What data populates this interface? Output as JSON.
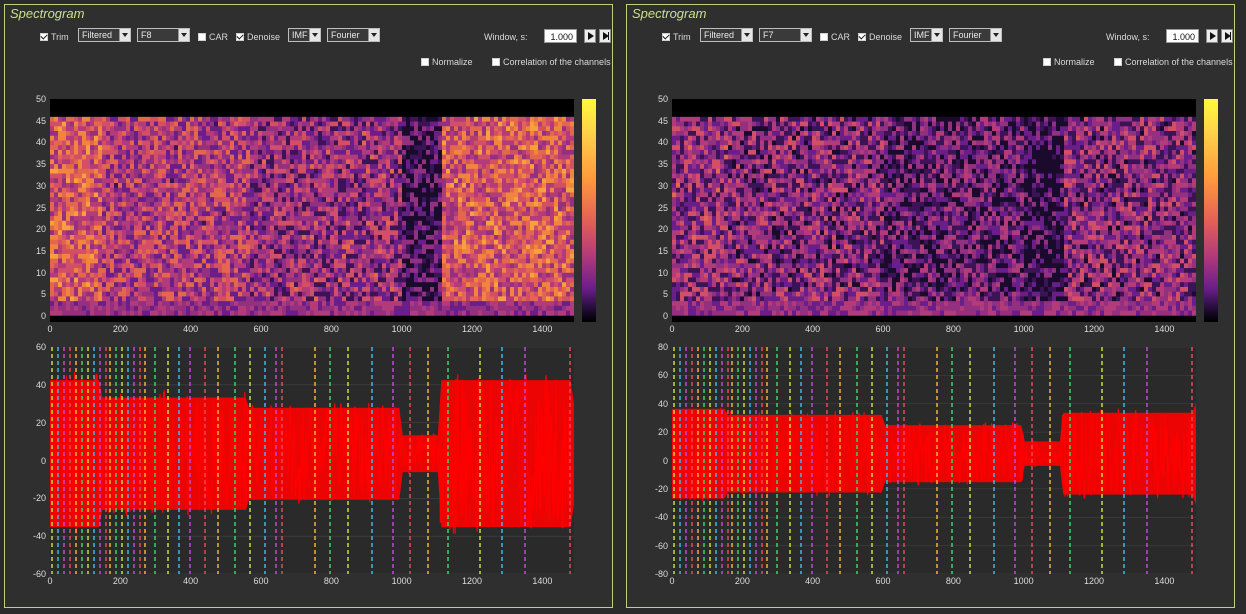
{
  "panels": [
    {
      "title": "Spectrogram",
      "trim_label": "Trim",
      "trim_checked": true,
      "source_value": "Filtered",
      "channel_value": "F8",
      "car_label": "CAR",
      "car_checked": false,
      "denoise_label": "Denoise",
      "denoise_checked": true,
      "imf_value": "IMF",
      "method_value": "Fourier",
      "window_label": "Window, s:",
      "window_value": "1.000",
      "normalize_label": "Normalize",
      "normalize_checked": false,
      "corr_label": "Correlation of the channels",
      "corr_checked": false,
      "spec_y_ticks": [
        "50",
        "45",
        "40",
        "35",
        "30",
        "25",
        "20",
        "15",
        "10",
        "5",
        "0"
      ],
      "x_ticks": [
        "0",
        "200",
        "400",
        "600",
        "800",
        "1000",
        "1200",
        "1400"
      ],
      "sig_y_ticks": [
        "60",
        "40",
        "20",
        "0",
        "-20",
        "-40",
        "-60"
      ],
      "sig_ylim": [
        -60,
        60
      ],
      "segments": [
        [
          0,
          140,
          0.72
        ],
        [
          140,
          560,
          0.55
        ],
        [
          560,
          1000,
          0.45
        ],
        [
          1000,
          1110,
          0.18
        ],
        [
          1110,
          1490,
          0.72
        ]
      ]
    },
    {
      "title": "Spectrogram",
      "trim_label": "Trim",
      "trim_checked": true,
      "source_value": "Filtered",
      "channel_value": "F7",
      "car_label": "CAR",
      "car_checked": false,
      "denoise_label": "Denoise",
      "denoise_checked": true,
      "imf_value": "IMF",
      "method_value": "Fourier",
      "window_label": "Window, s:",
      "window_value": "1.000",
      "normalize_label": "Normalize",
      "normalize_checked": false,
      "corr_label": "Correlation of the channels",
      "corr_checked": false,
      "spec_y_ticks": [
        "50",
        "45",
        "40",
        "35",
        "30",
        "25",
        "20",
        "15",
        "10",
        "5",
        "0"
      ],
      "x_ticks": [
        "0",
        "200",
        "400",
        "600",
        "800",
        "1000",
        "1200",
        "1400"
      ],
      "sig_y_ticks": [
        "80",
        "60",
        "40",
        "20",
        "0",
        "-20",
        "-40",
        "-60",
        "-80"
      ],
      "sig_ylim": [
        -80,
        80
      ],
      "segments": [
        [
          0,
          150,
          0.44
        ],
        [
          150,
          600,
          0.38
        ],
        [
          600,
          1000,
          0.28
        ],
        [
          1000,
          1110,
          0.12
        ],
        [
          1110,
          1490,
          0.4
        ]
      ]
    }
  ],
  "colors": {
    "panel_border": "#b9d37a",
    "signal": "#ff0000",
    "background": "#2b2b2b"
  },
  "marker_colors": [
    "#c6e03a",
    "#3fb7e8",
    "#c04bd6",
    "#e64a5a",
    "#f2b134",
    "#3ad46a"
  ]
}
